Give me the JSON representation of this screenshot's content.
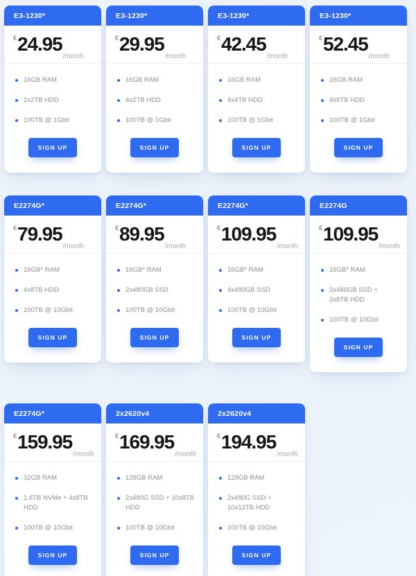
{
  "page": {
    "background_color": "#eef3fa",
    "accent_color": "#2f6bf0",
    "currency_symbol": "€",
    "period_label": "/month",
    "signup_label": "SIGN UP"
  },
  "rows": [
    {
      "cards": [
        {
          "title": "E3-1230*",
          "currency": "€",
          "price": "24.95",
          "period": "/month",
          "specs": [
            "16GB RAM",
            "2x2TB HDD",
            "100TB @ 1Gbit"
          ],
          "cta": "SIGN UP"
        },
        {
          "title": "E3-1230*",
          "currency": "€",
          "price": "29.95",
          "period": "/month",
          "specs": [
            "16GB RAM",
            "4x2TB HDD",
            "100TB @ 1Gbit"
          ],
          "cta": "SIGN UP"
        },
        {
          "title": "E3-1230*",
          "currency": "€",
          "price": "42.45",
          "period": "/month",
          "specs": [
            "16GB RAM",
            "4x4TB HDD",
            "100TB @ 1Gbit"
          ],
          "cta": "SIGN UP"
        },
        {
          "title": "E3-1230*",
          "currency": "€",
          "price": "52.45",
          "period": "/month",
          "specs": [
            "16GB RAM",
            "4x8TB HDD",
            "100TB @ 1Gbit"
          ],
          "cta": "SIGN UP"
        }
      ]
    },
    {
      "cards": [
        {
          "title": "E2274G*",
          "currency": "€",
          "price": "79.95",
          "period": "/month",
          "specs": [
            "16GB* RAM",
            "4x8TB HDD",
            "100TB @ 10Gbit"
          ],
          "cta": "SIGN UP"
        },
        {
          "title": "E2274G*",
          "currency": "€",
          "price": "89.95",
          "period": "/month",
          "specs": [
            "16GB* RAM",
            "2x480GB SSD",
            "100TB @ 10Gbit"
          ],
          "cta": "SIGN UP"
        },
        {
          "title": "E2274G*",
          "currency": "€",
          "price": "109.95",
          "period": "/month",
          "specs": [
            "16GB* RAM",
            "4x480GB SSD",
            "100TB @ 10Gbit"
          ],
          "cta": "SIGN UP"
        },
        {
          "title": "E2274G",
          "currency": "€",
          "price": "109.95",
          "period": "/month",
          "specs": [
            "16GB* RAM",
            "2x480GB SSD + 2x8TB HDD",
            "100TB @ 10Gbit"
          ],
          "cta": "SIGN UP"
        }
      ]
    },
    {
      "cards": [
        {
          "title": "E2274G*",
          "currency": "€",
          "price": "159.95",
          "period": "/month",
          "specs": [
            "32GB RAM",
            "1.6TB NVMe + 4x8TB HDD",
            "100TB @ 10Gbit"
          ],
          "cta": "SIGN UP"
        },
        {
          "title": "2x2620v4",
          "currency": "€",
          "price": "169.95",
          "period": "/month",
          "specs": [
            "128GB RAM",
            "2x480G SSD + 10x8TB HDD",
            "100TB @ 10Gbit"
          ],
          "cta": "SIGN UP"
        },
        {
          "title": "2x2620v4",
          "currency": "€",
          "price": "194.95",
          "period": "/month",
          "specs": [
            "128GB RAM",
            "2x480G SSD + 10x12TB HDD",
            "100TB @ 10Gbit"
          ],
          "cta": "SIGN UP"
        }
      ]
    }
  ]
}
